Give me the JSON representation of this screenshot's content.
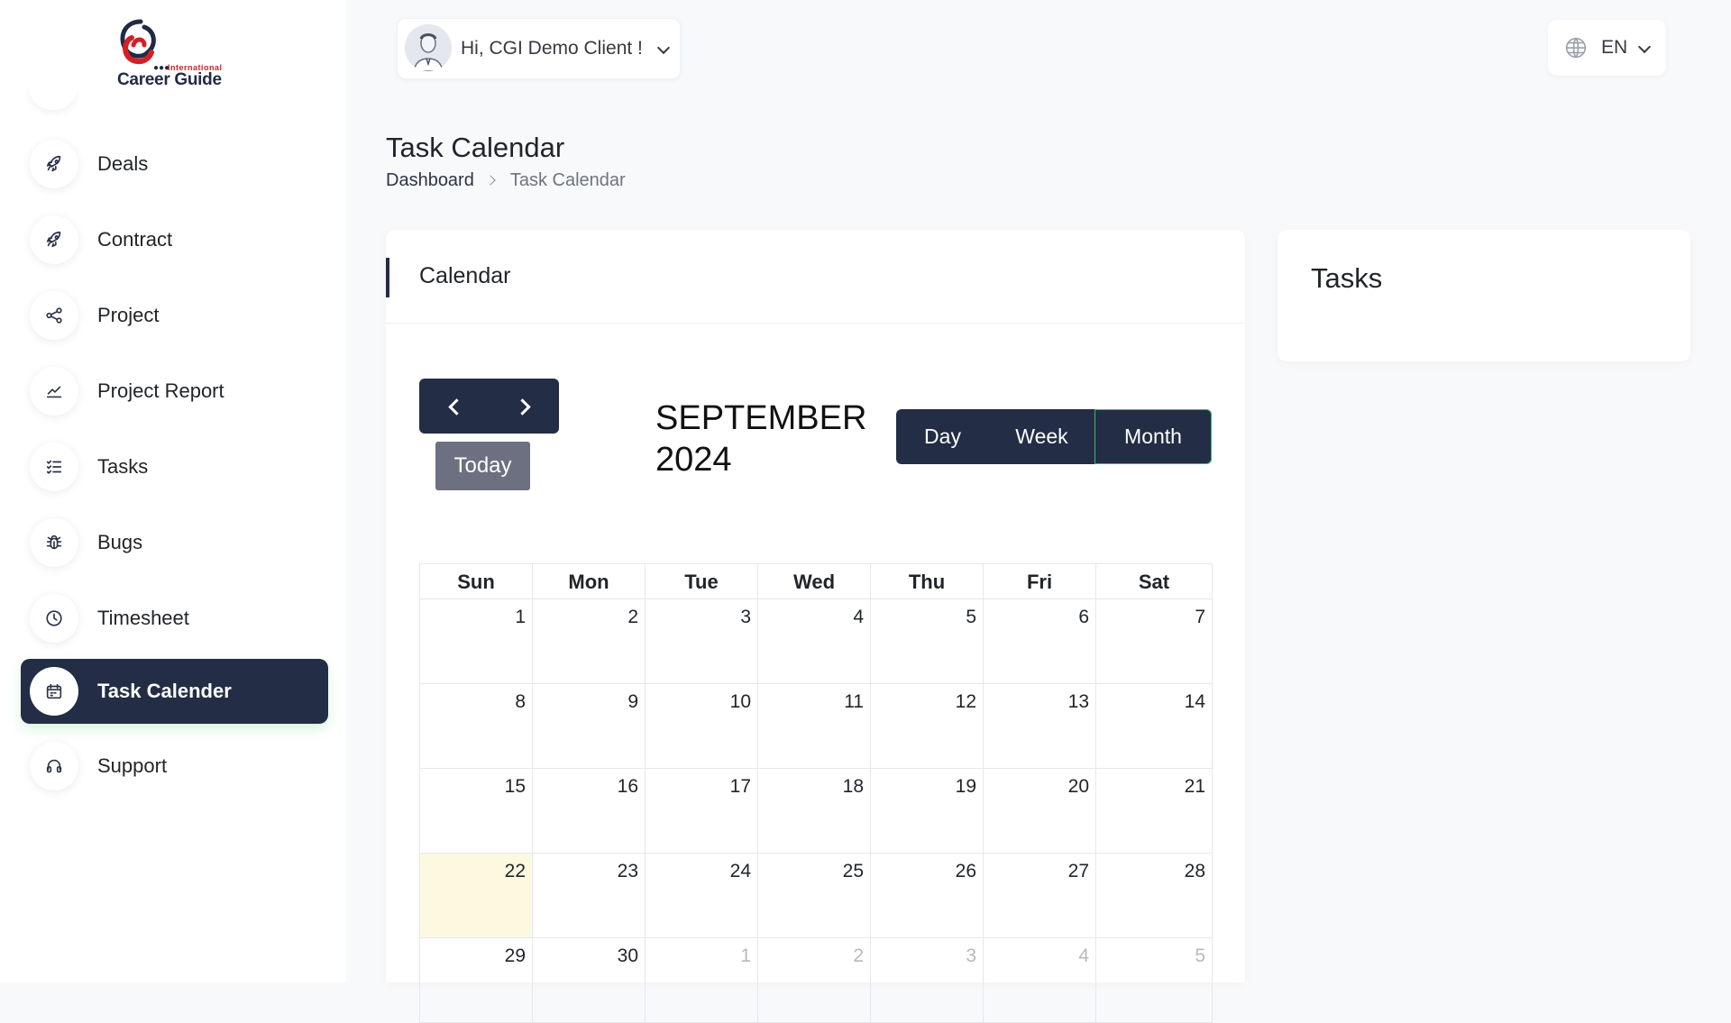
{
  "brand": {
    "line1": "International",
    "line2": "Career Guide"
  },
  "sidebar": {
    "items": [
      {
        "label": "Deals",
        "icon": "rocket-icon"
      },
      {
        "label": "Contract",
        "icon": "rocket-icon"
      },
      {
        "label": "Project",
        "icon": "share-icon"
      },
      {
        "label": "Project Report",
        "icon": "chart-line-icon"
      },
      {
        "label": "Tasks",
        "icon": "list-check-icon"
      },
      {
        "label": "Bugs",
        "icon": "bug-icon"
      },
      {
        "label": "Timesheet",
        "icon": "clock-icon"
      },
      {
        "label": "Task Calender",
        "icon": "calendar-icon",
        "active": true
      },
      {
        "label": "Support",
        "icon": "headset-icon"
      }
    ]
  },
  "header": {
    "greeting": "Hi, CGI Demo Client !",
    "language": "EN"
  },
  "page": {
    "title": "Task Calendar",
    "breadcrumb": [
      "Dashboard",
      "Task Calendar"
    ]
  },
  "calendar": {
    "card_title": "Calendar",
    "today_label": "Today",
    "month_line1": "SEPTEMBER",
    "month_line2": "2024",
    "views": [
      "Day",
      "Week",
      "Month"
    ],
    "active_view": "Month",
    "weekdays": [
      "Sun",
      "Mon",
      "Tue",
      "Wed",
      "Thu",
      "Fri",
      "Sat"
    ],
    "weeks": [
      [
        "1",
        "2",
        "3",
        "4",
        "5",
        "6",
        "7"
      ],
      [
        "8",
        "9",
        "10",
        "11",
        "12",
        "13",
        "14"
      ],
      [
        "15",
        "16",
        "17",
        "18",
        "19",
        "20",
        "21"
      ],
      [
        "22",
        "23",
        "24",
        "25",
        "26",
        "27",
        "28"
      ],
      [
        "29",
        "30",
        "1",
        "2",
        "3",
        "4",
        "5"
      ]
    ],
    "today_date": "22",
    "colors": {
      "primary": "#232d45",
      "today_bg": "#fdf8e0",
      "accent": "#3fb67a"
    }
  },
  "tasks": {
    "title": "Tasks"
  }
}
